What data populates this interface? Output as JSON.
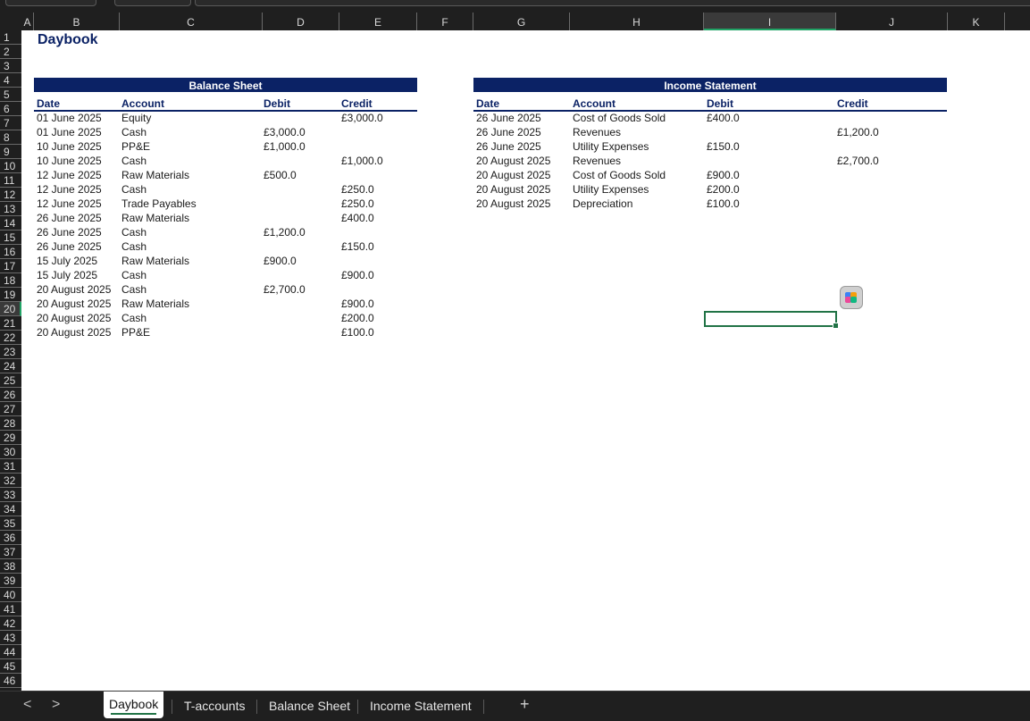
{
  "sheet": {
    "title": "Daybook",
    "columns": [
      "A",
      "B",
      "C",
      "D",
      "E",
      "F",
      "G",
      "H",
      "I",
      "J",
      "K"
    ],
    "selected_column": "I",
    "rows": [
      "1",
      "2",
      "3",
      "4",
      "5",
      "6",
      "7",
      "8",
      "9",
      "10",
      "11",
      "12",
      "13",
      "14",
      "15",
      "16",
      "17",
      "18",
      "19",
      "20",
      "21",
      "22",
      "23",
      "24",
      "25",
      "26",
      "27",
      "28",
      "29",
      "30",
      "31",
      "32",
      "33",
      "34",
      "35",
      "36",
      "37",
      "38",
      "39",
      "40",
      "41",
      "42",
      "43",
      "44",
      "45",
      "46"
    ],
    "selected_row": "20"
  },
  "balance_sheet": {
    "band": "Balance Sheet",
    "headers": [
      "Date",
      "Account",
      "Debit",
      "Credit"
    ],
    "rows": [
      [
        "01 June 2025",
        "Equity",
        "",
        "£3,000.0"
      ],
      [
        "01 June 2025",
        "Cash",
        "£3,000.0",
        ""
      ],
      [
        "10 June 2025",
        "PP&E",
        "£1,000.0",
        ""
      ],
      [
        "10 June 2025",
        "Cash",
        "",
        "£1,000.0"
      ],
      [
        "12 June 2025",
        "Raw Materials",
        "£500.0",
        ""
      ],
      [
        "12 June 2025",
        "Cash",
        "",
        "£250.0"
      ],
      [
        "12 June 2025",
        "Trade Payables",
        "",
        "£250.0"
      ],
      [
        "26 June 2025",
        "Raw Materials",
        "",
        "£400.0"
      ],
      [
        "26 June 2025",
        "Cash",
        "£1,200.0",
        ""
      ],
      [
        "26 June 2025",
        "Cash",
        "",
        "£150.0"
      ],
      [
        "15 July 2025",
        "Raw Materials",
        "£900.0",
        ""
      ],
      [
        "15 July 2025",
        "Cash",
        "",
        "£900.0"
      ],
      [
        "20 August 2025",
        "Cash",
        "£2,700.0",
        ""
      ],
      [
        "20 August 2025",
        "Raw Materials",
        "",
        "£900.0"
      ],
      [
        "20 August 2025",
        "Cash",
        "",
        "£200.0"
      ],
      [
        "20 August 2025",
        "PP&E",
        "",
        "£100.0"
      ]
    ]
  },
  "income_statement": {
    "band": "Income Statement",
    "headers": [
      "Date",
      "Account",
      "Debit",
      "Credit"
    ],
    "rows": [
      [
        "26 June 2025",
        "Cost of Goods Sold",
        "£400.0",
        ""
      ],
      [
        "26 June 2025",
        "Revenues",
        "",
        "£1,200.0"
      ],
      [
        "26 June 2025",
        "Utility Expenses",
        "£150.0",
        ""
      ],
      [
        "20 August 2025",
        "Revenues",
        "",
        "£2,700.0"
      ],
      [
        "20 August 2025",
        "Cost of Goods Sold",
        "£900.0",
        ""
      ],
      [
        "20 August 2025",
        "Utility Expenses",
        "£200.0",
        ""
      ],
      [
        "20 August 2025",
        "Depreciation",
        "£100.0",
        ""
      ]
    ]
  },
  "tabs": {
    "nav_prev": "<",
    "nav_next": ">",
    "items": [
      "Daybook",
      "T-accounts",
      "Balance Sheet",
      "Income Statement"
    ],
    "active": "Daybook",
    "add": "+"
  },
  "icons": {
    "copilot": "copilot-icon",
    "select_all": "select-all-triangle-icon"
  },
  "colors": {
    "navy": "#0b2265",
    "excel_green": "#217346"
  }
}
